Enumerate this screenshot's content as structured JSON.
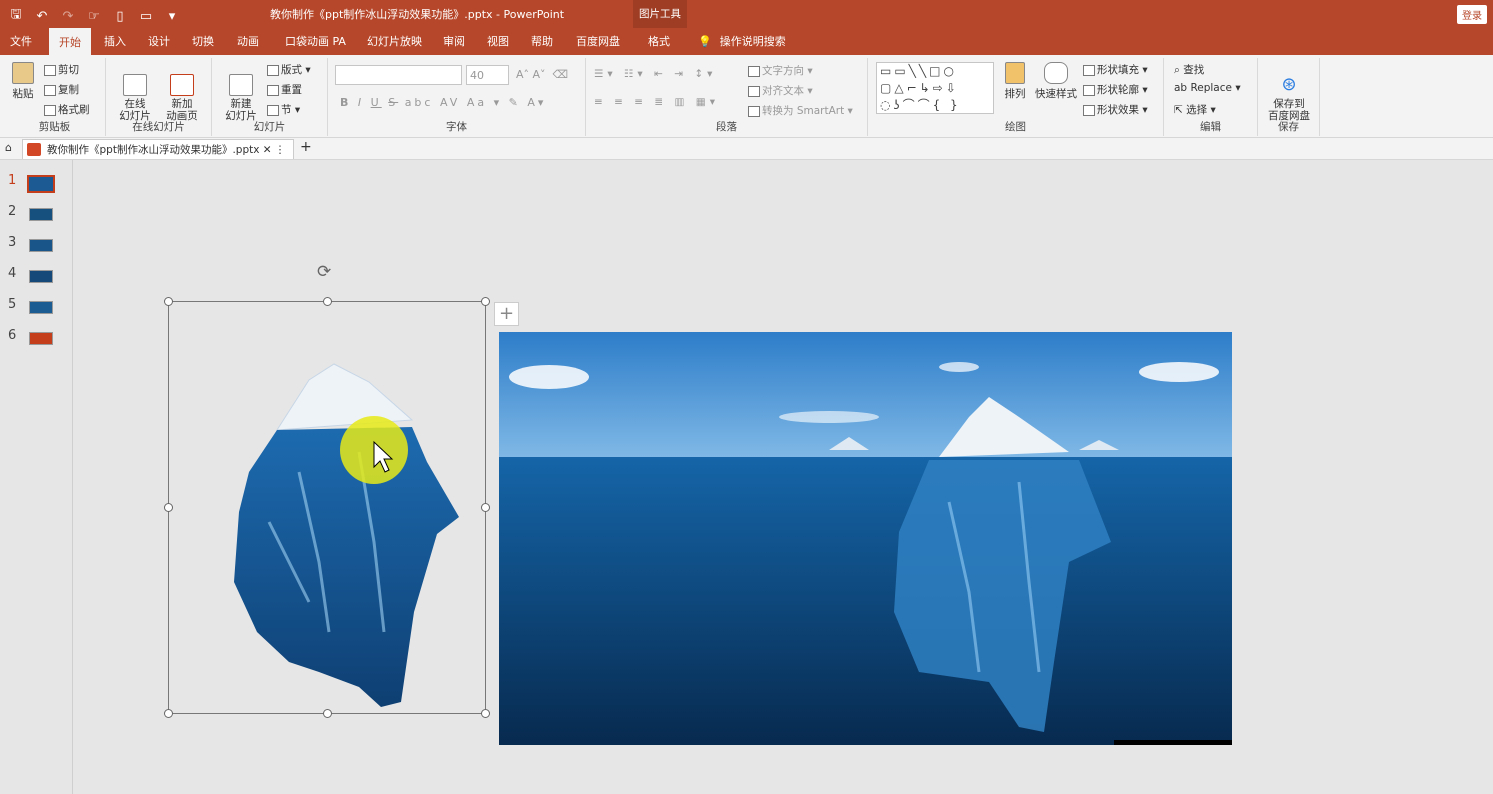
{
  "window": {
    "title": "教你制作《ppt制作冰山浮动效果功能》.pptx  -  PowerPoint",
    "context_group": "图片工具",
    "login": "登录"
  },
  "tabs": [
    "文件",
    "开始",
    "插入",
    "设计",
    "切换",
    "动画",
    "口袋动画 PA",
    "幻灯片放映",
    "审阅",
    "视图",
    "帮助",
    "百度网盘",
    "格式"
  ],
  "active_tab": "开始",
  "tell_me": "操作说明搜索",
  "ribbon": {
    "clipboard": {
      "paste": "粘贴",
      "cut": "剪切",
      "copy": "复制",
      "format_painter": "格式刷",
      "label": "剪贴板"
    },
    "online_slides": {
      "online": "在线\n幻灯片",
      "new_anim": "新加\n动画页",
      "label": "在线幻灯片"
    },
    "slides": {
      "new_slide": "新建\n幻灯片",
      "layout": "版式",
      "reset": "重置",
      "section": "节",
      "label": "幻灯片"
    },
    "font": {
      "size": "40",
      "label": "字体",
      "bold": "B",
      "italic": "I",
      "underline": "U",
      "strike": "S",
      "abc": "abc",
      "av": "AV",
      "aa": "Aa",
      "a": "A"
    },
    "paragraph": {
      "text_dir": "文字方向",
      "align_text": "对齐文本",
      "smartart": "转换为 SmartArt",
      "label": "段落"
    },
    "drawing": {
      "arrange": "排列",
      "quick_styles": "快速样式",
      "fill": "形状填充",
      "outline": "形状轮廓",
      "effects": "形状效果",
      "label": "绘图"
    },
    "editing": {
      "find": "查找",
      "replace": "Replace",
      "select": "选择",
      "label": "编辑"
    },
    "save": {
      "save_baidu": "保存到\n百度网盘",
      "label": "保存"
    }
  },
  "doc_tab": "教你制作《ppt制作冰山浮动效果功能》.pptx",
  "thumbnails": [
    "1",
    "2",
    "3",
    "4",
    "5",
    "6"
  ],
  "colors": {
    "accent": "#b7472a",
    "ocean": "#0c3f6e",
    "sky": "#3b8fd6"
  }
}
